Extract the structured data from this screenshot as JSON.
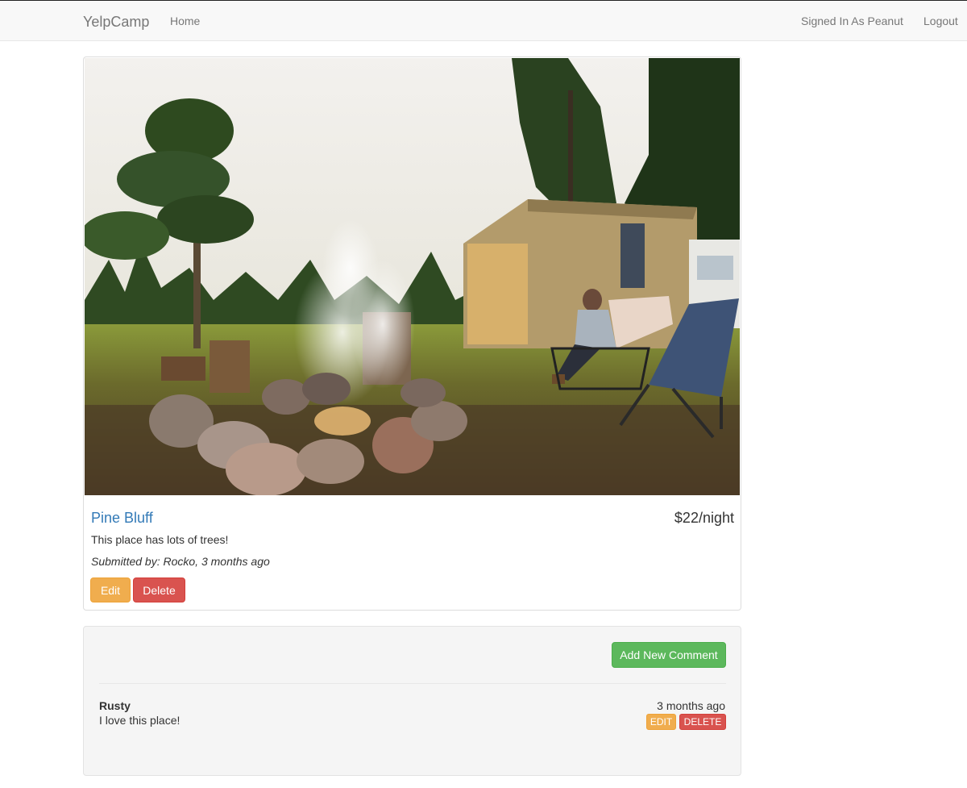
{
  "navbar": {
    "brand": "YelpCamp",
    "home": "Home",
    "signed_in": "Signed In As Peanut",
    "logout": "Logout"
  },
  "campground": {
    "name": "Pine Bluff",
    "price": "$22/night",
    "description": "This place has lots of trees!",
    "submitted": "Submitted by: Rocko, 3 months ago",
    "edit_label": "Edit",
    "delete_label": "Delete"
  },
  "comments": {
    "add_label": "Add New Comment",
    "items": [
      {
        "author": "Rusty",
        "text": "I love this place!",
        "time": "3 months ago",
        "edit_label": "EDIT",
        "delete_label": "DELETE"
      }
    ]
  },
  "colors": {
    "link": "#337ab7",
    "warning": "#f0ad4e",
    "danger": "#d9534f",
    "success": "#5cb85c"
  }
}
